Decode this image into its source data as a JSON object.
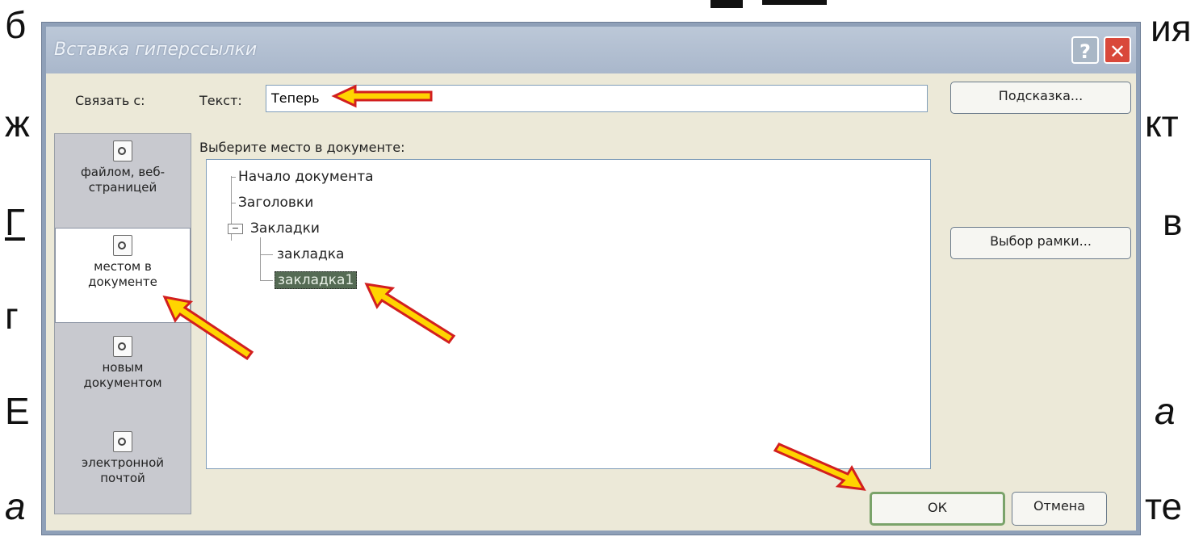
{
  "background_fragments": [
    "б",
    "ия",
    "ж",
    "кт",
    "Г",
    "в",
    "г",
    "Е",
    "а",
    "а",
    "те"
  ],
  "dialog": {
    "title": "Вставка гиперссылки",
    "help_glyph": "?",
    "close_glyph": "✕",
    "link_to_label": "Связать с:",
    "nav_items": [
      {
        "label_line1": "файлом, веб-",
        "label_line2": "страницей",
        "icon": "web-page-icon"
      },
      {
        "label_line1": "местом в",
        "label_line2": "документе",
        "icon": "place-in-document-icon",
        "selected": true
      },
      {
        "label_line1": "новым",
        "label_line2": "документом",
        "icon": "new-document-icon"
      },
      {
        "label_line1": "электронной",
        "label_line2": "почтой",
        "icon": "email-icon"
      }
    ],
    "text_label": "Текст:",
    "text_value": "Теперь",
    "hint_button": "Подсказка...",
    "choose_label": "Выберите место в документе:",
    "tree": [
      "Начало документа",
      "Заголовки",
      "Закладки",
      "закладка",
      "закладка1"
    ],
    "tree_expander": "−",
    "frame_button": "Выбор рамки...",
    "ok_button": "ОК",
    "cancel_button": "Отмена"
  },
  "colors": {
    "dialog_bg": "#ece9d8",
    "selection": "#556b54",
    "arrow_fill": "#ffd400",
    "arrow_stroke": "#d21f1f"
  }
}
